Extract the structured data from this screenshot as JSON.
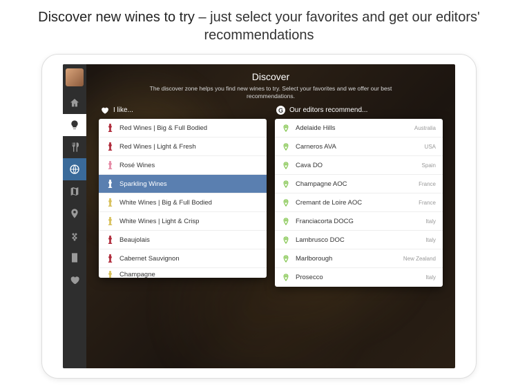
{
  "promo": {
    "strong": "Discover new wines to try",
    "rest": " – just select your favorites and get our editors' recommendations"
  },
  "page": {
    "title": "Discover",
    "subtitle": "The discover zone helps you find new wines to try. Select your favorites and we offer our best recommendations."
  },
  "headers": {
    "like": "I like...",
    "recommend": "Our editors recommend..."
  },
  "likes": [
    {
      "label": "Red Wines | Big & Full Bodied",
      "color": "#b02a3a",
      "selected": false
    },
    {
      "label": "Red Wines | Light & Fresh",
      "color": "#b02a3a",
      "selected": false
    },
    {
      "label": "Rosé Wines",
      "color": "#e68aa6",
      "selected": false
    },
    {
      "label": "Sparkling Wines",
      "color": "#5a7fb0",
      "selected": true
    },
    {
      "label": "White Wines | Big & Full Bodied",
      "color": "#d8c05a",
      "selected": false
    },
    {
      "label": "White Wines | Light & Crisp",
      "color": "#d8c05a",
      "selected": false
    },
    {
      "label": "Beaujolais",
      "color": "#b02a3a",
      "selected": false
    },
    {
      "label": "Cabernet Sauvignon",
      "color": "#b02a3a",
      "selected": false
    },
    {
      "label": "Champagne",
      "color": "#d8c05a",
      "selected": false,
      "cut": true
    }
  ],
  "recommendations": [
    {
      "label": "Adelaide Hills",
      "country": "Australia"
    },
    {
      "label": "Carneros AVA",
      "country": "USA"
    },
    {
      "label": "Cava DO",
      "country": "Spain"
    },
    {
      "label": "Champagne AOC",
      "country": "France"
    },
    {
      "label": "Cremant de Loire AOC",
      "country": "France"
    },
    {
      "label": "Franciacorta DOCG",
      "country": "Italy"
    },
    {
      "label": "Lambrusco DOC",
      "country": "Italy"
    },
    {
      "label": "Marlborough",
      "country": "New Zealand"
    },
    {
      "label": "Prosecco",
      "country": "Italy"
    }
  ],
  "nav": [
    {
      "name": "home",
      "active": false
    },
    {
      "name": "discover",
      "active": true
    },
    {
      "name": "food",
      "active": false
    },
    {
      "name": "globe",
      "active": false
    },
    {
      "name": "map",
      "active": false
    },
    {
      "name": "location",
      "active": false
    },
    {
      "name": "grapes",
      "active": false
    },
    {
      "name": "notes",
      "active": false
    },
    {
      "name": "favorites",
      "active": false
    }
  ]
}
